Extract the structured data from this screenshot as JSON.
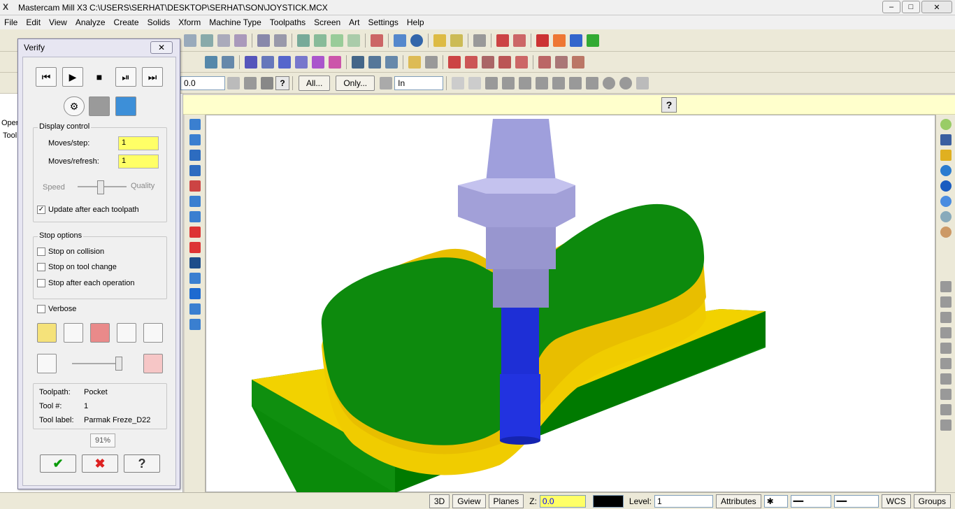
{
  "window": {
    "title": "Mastercam Mill X3  C:\\USERS\\SERHAT\\DESKTOP\\SERHAT\\SON\\JOYSTICK.MCX",
    "min": "–",
    "max": "□",
    "close": "✕"
  },
  "menu": [
    "File",
    "Edit",
    "View",
    "Analyze",
    "Create",
    "Solids",
    "Xform",
    "Machine Type",
    "Toolpaths",
    "Screen",
    "Art",
    "Settings",
    "Help"
  ],
  "toolbar3": {
    "value": "0.0",
    "all_btn": "All...",
    "only_btn": "Only...",
    "in_select": "In",
    "help": "?"
  },
  "prompt_help": "?",
  "left_panel": {
    "tab1": "Oper",
    "tab2": "Tool"
  },
  "dialog": {
    "title": "Verify",
    "close": "✕",
    "display_control": {
      "label": "Display control",
      "moves_step_label": "Moves/step:",
      "moves_step_value": "1",
      "moves_refresh_label": "Moves/refresh:",
      "moves_refresh_value": "1",
      "speed_label": "Speed",
      "quality_label": "Quality",
      "update_label": "Update after each toolpath",
      "update_checked": true
    },
    "stop_options": {
      "label": "Stop options",
      "collision": "Stop on collision",
      "tool_change": "Stop on tool change",
      "each_operation": "Stop after each operation"
    },
    "verbose": "Verbose",
    "info": {
      "toolpath_label": "Toolpath:",
      "toolpath_value": "Pocket",
      "tool_no_label": "Tool #:",
      "tool_no_value": "1",
      "tool_label_label": "Tool label:",
      "tool_label_value": "Parmak Freze_D22"
    },
    "progress": "91%",
    "ok": "✔",
    "cancel": "✖",
    "help": "?"
  },
  "statusbar": {
    "btn_3d": "3D",
    "gview": "Gview",
    "planes": "Planes",
    "z_label": "Z:",
    "z_value": "0.0",
    "level_label": "Level:",
    "level_value": "1",
    "attributes": "Attributes",
    "wcs": "WCS",
    "groups": "Groups"
  }
}
